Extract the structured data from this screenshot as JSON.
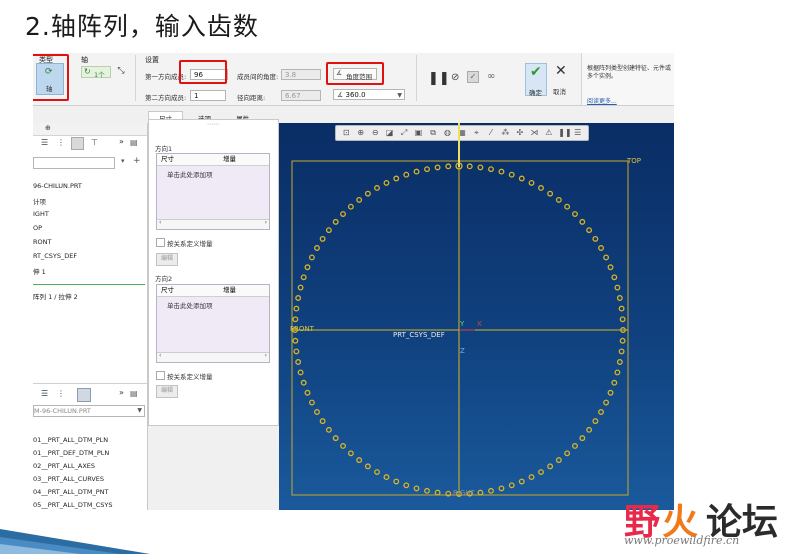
{
  "slide_title": "2.轴阵列，输入齿数",
  "ribbon": {
    "type_group": "类型",
    "type_item": "轴",
    "axis_group": "轴",
    "axis_value": "1个",
    "settings_group": "设置",
    "dir1_label": "第一方向成员:",
    "dir1_value": "96",
    "dir2_label": "第二方向成员:",
    "dir2_value": "1",
    "angle_between_label": "成员间的角度:",
    "angle_between_value": "3.8",
    "radial_label": "径向距离:",
    "radial_value": "6.67",
    "angle_range_label": "角度范围",
    "angle_range_value": "360.0",
    "ok_label": "确定",
    "cancel_label": "取消",
    "help_text": "根据阵列类型创建特征、元件或多个实例。",
    "learn_more": "阅读更多..."
  },
  "tabs": [
    "尺寸",
    "选项",
    "属性"
  ],
  "tree_top": {
    "items": [
      "96-CHILUN.PRT",
      "计项",
      "IGHT",
      "OP",
      "RONT",
      "RT_CSYS_DEF",
      "伸 1",
      "阵列 1 / 拉伸 2"
    ]
  },
  "tree_bottom": {
    "items": [
      "M-96-CHILUN.PRT",
      "01__PRT_ALL_DTM_PLN",
      "01__PRT_DEF_DTM_PLN",
      "02__PRT_ALL_AXES",
      "03__PRT_ALL_CURVES",
      "04__PRT_ALL_DTM_PNT",
      "05__PRT_ALL_DTM_CSYS"
    ]
  },
  "dash": {
    "dir1_title": "方向1",
    "dir2_title": "方向2",
    "col_dim": "尺寸",
    "col_inc": "增量",
    "add_item": "单击此处添加项",
    "relation_label": "按关系定义增量",
    "edit_btn": "编辑"
  },
  "viewport": {
    "labels": {
      "top": "TOP",
      "front": "FRONT",
      "csys": "PRT_CSYS_DEF",
      "x": "X",
      "y": "Y",
      "z": "Z",
      "right": "RIGHT"
    },
    "pattern_members": 96
  },
  "watermark": {
    "c1": "野",
    "c2": "火",
    "c3": "论坛",
    "url": "www.proewildfire.cn"
  },
  "colors": {
    "datum": "#d7b526",
    "accent_red": "#e31010",
    "viewport_bg": "#10417f"
  }
}
